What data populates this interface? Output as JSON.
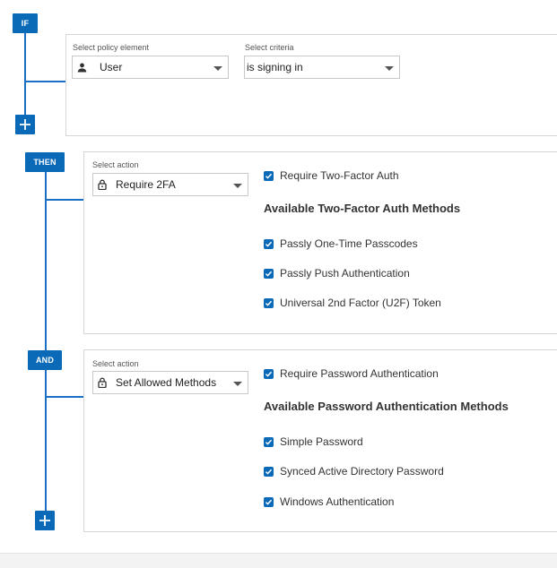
{
  "if_block": {
    "tag": "IF",
    "policy_element_label": "Select policy element",
    "policy_element_value": "User",
    "criteria_label": "Select criteria",
    "criteria_value": "is signing in"
  },
  "then_block": {
    "tag": "THEN",
    "action_label": "Select action",
    "action_value": "Require 2FA",
    "require_label": "Require Two-Factor Auth",
    "methods_heading": "Available Two-Factor Auth Methods",
    "methods": [
      {
        "label": "Passly One-Time Passcodes",
        "checked": true
      },
      {
        "label": "Passly Push Authentication",
        "checked": true
      },
      {
        "label": "Universal 2nd Factor (U2F) Token",
        "checked": true
      }
    ]
  },
  "and_block": {
    "tag": "AND",
    "action_label": "Select action",
    "action_value": "Set Allowed Methods",
    "require_label": "Require Password Authentication",
    "methods_heading": "Available Password Authentication Methods",
    "methods": [
      {
        "label": "Simple Password",
        "checked": true
      },
      {
        "label": "Synced Active Directory Password",
        "checked": true
      },
      {
        "label": "Windows Authentication",
        "checked": true
      }
    ]
  },
  "colors": {
    "accent": "#0a6ab8",
    "connector": "#1a6fc4",
    "panel_border": "#d6d6d6"
  },
  "icons": {
    "user": "person-icon",
    "lock": "lock-icon",
    "add": "plus-icon",
    "dropdown": "chevron-down-icon",
    "checkbox": "check-icon"
  }
}
